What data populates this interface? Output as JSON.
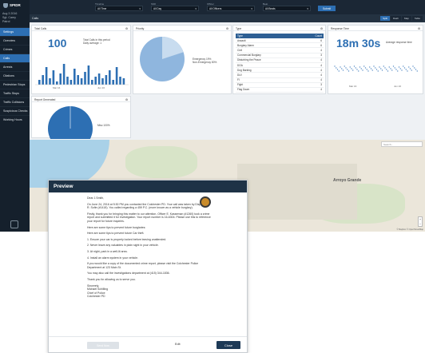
{
  "app": {
    "brand": "SPIDR"
  },
  "user": {
    "date": "Aug 3 2016",
    "name": "Sgt. Carey",
    "role": "Patrol"
  },
  "sidebar": {
    "items": [
      {
        "label": "Settings",
        "active": true
      },
      {
        "label": "Overview",
        "active": false
      },
      {
        "label": "Crimes",
        "active": false
      },
      {
        "label": "Calls",
        "active": true
      },
      {
        "label": "Arrests",
        "active": false
      },
      {
        "label": "Citations",
        "active": false
      },
      {
        "label": "Pedestrian Stops",
        "active": false
      },
      {
        "label": "Traffic Stops",
        "active": false
      },
      {
        "label": "Traffic Collisions",
        "active": false
      },
      {
        "label": "Suspicious Checks",
        "active": false
      },
      {
        "label": "Working Hours",
        "active": false
      }
    ]
  },
  "filters": [
    {
      "label": "Timeline",
      "value": "All Time"
    },
    {
      "label": "Shift",
      "value": "All Day"
    },
    {
      "label": "Officer",
      "value": "All Officers"
    },
    {
      "label": "Beat",
      "value": "All Beats"
    }
  ],
  "submit_label": "Submit",
  "subbar": {
    "title": "Calls",
    "tabs": [
      "Split",
      "Dash",
      "Map",
      "Table"
    ],
    "active_tab": "Split"
  },
  "cards": {
    "total_calls": {
      "title": "Total Calls",
      "value": "100",
      "note1": "Total Calls in this period",
      "note2": "Daily average: 1",
      "xticks": [
        "Mar 16",
        "Jun 16"
      ]
    },
    "priority": {
      "title": "Priority",
      "legend": [
        "Emergency 19%",
        "Non-Emergency 80%"
      ]
    },
    "type": {
      "title": "Type",
      "header": [
        "Type",
        "Count"
      ],
      "rows": [
        [
          "Assault",
          "6"
        ],
        [
          "Burglary Alarm",
          "6"
        ],
        [
          "Civil",
          "4"
        ],
        [
          "Commercial Burglary",
          "3"
        ],
        [
          "Disturbing the Peace",
          "4"
        ],
        [
          "DOA",
          "4"
        ],
        [
          "Dog Barking",
          "4"
        ],
        [
          "DUI",
          "4"
        ],
        [
          "FI",
          "4"
        ],
        [
          "Fight",
          "3"
        ],
        [
          "Flag Down",
          "4"
        ]
      ]
    },
    "response_time": {
      "title": "Response Time",
      "value": "18m 30s",
      "note1": "Average response time",
      "xticks": [
        "Mar 16",
        "Jun 16"
      ]
    },
    "report_generated": {
      "title": "Report Generated",
      "legend": [
        "Misc 100%"
      ]
    }
  },
  "map": {
    "search_placeholder": "Search...",
    "label": "Arroyo Grande",
    "credits": "© Mapbox © OpenStreetMap"
  },
  "modal": {
    "title": "Preview",
    "greeting": "Dear J.Smith,",
    "p1": "On June 24, 2016 at 5:30 PM you contacted the Colchester PD. Your call was taken by Dispatcher R. Sofie (#1418). You called regarding a 459 P.C. (more known as a vehicle burglary).",
    "p2": "Firstly, thank you for bringing this matter to our attention. Officer E. Kasseman (#1260) took a crime report and submitted it for investigation. Your report number is 16-6304. Please use this to reference your report for future inquiries.",
    "p3": "Here are some tips to prevent future burglaries:",
    "tips_intro": "Here are some tips to prevent future Car theft.",
    "tip1": "1. Ensure your car is properly locked before leaving unattended.",
    "tip2": "2. Never leave any valuables in plain sight in your vehicle.",
    "tip3": "3. At night, park in a well-lit area.",
    "tip4": "4. Install an alarm system in your vehicle.",
    "p4": "If you would like a copy of the documented crime report, please visit the Colchester Police Department at 123 Main St.",
    "p5": "You may also call the investigations department at (415) 344-1836.",
    "p6": "Thank you for allowing us to serve you.",
    "sig1": "Sincerely,",
    "sig2": "Michael Schilling",
    "sig3": "Chief of Police",
    "sig4": "Colchester PD",
    "send_label": "Send Now",
    "edit_label": "Edit",
    "close_label": "Close"
  },
  "colors": {
    "accent": "#2d6fb3",
    "sidebar": "#15202c",
    "modal_header": "#1e3246"
  }
}
